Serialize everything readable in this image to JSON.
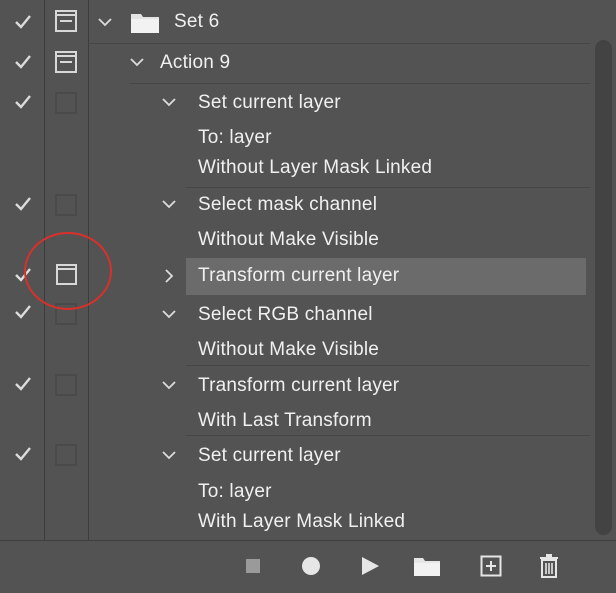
{
  "actions_panel": {
    "set": {
      "name": "Set 6",
      "enabled": true
    },
    "action": {
      "name": "Action 9",
      "enabled": true
    },
    "steps": [
      {
        "title": "Set current layer",
        "details": [
          "To: layer",
          "Without Layer Mask Linked"
        ],
        "expanded": true
      },
      {
        "title": "Select mask channel",
        "details": [
          "Without Make Visible"
        ],
        "expanded": true
      },
      {
        "title": "Transform current layer",
        "details": [],
        "expanded": false,
        "selected": true,
        "dialog_on": true
      },
      {
        "title": "Select RGB channel",
        "details": [
          "Without Make Visible"
        ],
        "expanded": true
      },
      {
        "title": "Transform current layer",
        "details": [
          "With Last Transform"
        ],
        "expanded": true
      },
      {
        "title": "Set current layer",
        "details": [
          "To: layer",
          "With Layer Mask Linked"
        ],
        "expanded": true
      }
    ]
  },
  "toolbar": {
    "buttons": [
      "stop-icon",
      "record-icon",
      "play-icon",
      "new-set-icon",
      "new-action-icon",
      "delete-icon"
    ]
  },
  "colors": {
    "panel_bg": "#535353",
    "selected_row": "#6b6b6b",
    "annotation": "#d9302c",
    "text": "#f0f0f0"
  }
}
